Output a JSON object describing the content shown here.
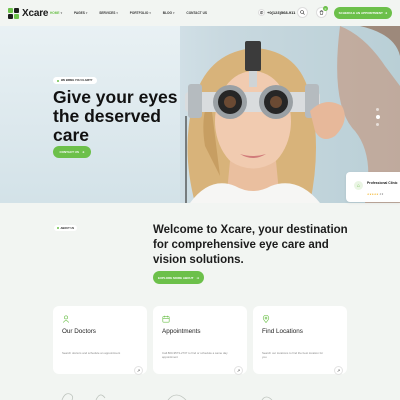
{
  "brand": {
    "name": "Xcare",
    "accent": "#6cc04a",
    "logo_colors": [
      "#6cc04a",
      "#1c1c1c"
    ]
  },
  "header": {
    "nav": [
      {
        "label": "Home",
        "active": true,
        "has_dropdown": true
      },
      {
        "label": "Pages",
        "active": false,
        "has_dropdown": true
      },
      {
        "label": "Services",
        "active": false,
        "has_dropdown": true
      },
      {
        "label": "Portfolio",
        "active": false,
        "has_dropdown": true
      },
      {
        "label": "Blog",
        "active": false,
        "has_dropdown": true
      },
      {
        "label": "Contact us",
        "active": false,
        "has_dropdown": false
      }
    ],
    "phone": "+0(123)568-911",
    "search_icon": "search-icon",
    "cart_icon": "cart-icon",
    "cart_count": "0",
    "appointment_label": "Schedule an appointment"
  },
  "hero": {
    "badge": "We bring you clarity",
    "title": "Give your eyes the deserved care",
    "button_label": "Contact us",
    "slides": 3,
    "active_slide": 2
  },
  "clinic_card": {
    "title": "Professional Clinic",
    "rating_stars": "★★★★★",
    "rating_text": "4.9"
  },
  "about": {
    "eyebrow": "About us",
    "headline": "Welcome to Xcare, your destination for comprehensive eye care and vision solutions.",
    "button_label": "Explore more about"
  },
  "cards": [
    {
      "title": "Our Doctors",
      "icon": "doctor-icon",
      "text": "Search doctors and schedule an appointment"
    },
    {
      "title": "Appointments",
      "icon": "calendar-icon",
      "text": "Call 800-9573-2737 to find or schedule a same day appointment"
    },
    {
      "title": "Find Locations",
      "icon": "location-icon",
      "text": "Search our locations to find the best location for you"
    }
  ]
}
